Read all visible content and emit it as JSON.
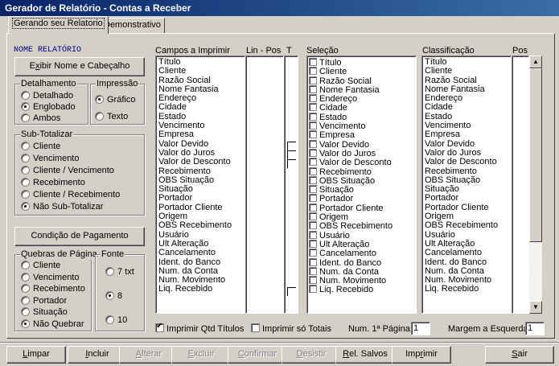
{
  "window": {
    "title": "Gerador de Relatório - Contas a Receber"
  },
  "tabs": [
    {
      "label": "Gerando seu Relatorio",
      "active": true
    },
    {
      "label": "Demonstrativo",
      "active": false
    }
  ],
  "left": {
    "section_title": "NOME RELATÓRIO",
    "exibir_button": {
      "pre": "E",
      "underline": "x",
      "post": "ibir Nome e Cabeçalho"
    },
    "detalhamento": {
      "label": "Detalhamento",
      "options": [
        {
          "label": "Detalhado",
          "selected": false
        },
        {
          "label": "Englobado",
          "selected": true
        },
        {
          "label": "Ambos",
          "selected": false
        }
      ]
    },
    "impressao": {
      "label": "Impressão",
      "options": [
        {
          "label": "Gráfico",
          "selected": true
        },
        {
          "label": "Texto",
          "selected": false
        }
      ]
    },
    "subtotalizar": {
      "label": "Sub-Totalizar",
      "options": [
        {
          "label": "Cliente",
          "selected": false
        },
        {
          "label": "Vencimento",
          "selected": false
        },
        {
          "label": "Cliente / Vencimento",
          "selected": false
        },
        {
          "label": "Recebimento",
          "selected": false
        },
        {
          "label": "Cliente / Recebimento",
          "selected": false
        },
        {
          "label": "Não Sub-Totalizar",
          "selected": true
        }
      ]
    },
    "condicao_button": "Condição de Pagamento",
    "quebras": {
      "label": "Quebras de Página",
      "options": [
        {
          "label": "Cliente",
          "selected": false
        },
        {
          "label": "Vencimento",
          "selected": false
        },
        {
          "label": "Recebimento",
          "selected": false
        },
        {
          "label": "Portador",
          "selected": false
        },
        {
          "label": "Situação",
          "selected": false
        },
        {
          "label": "Não Quebrar",
          "selected": true
        }
      ]
    },
    "fonte": {
      "label": "Fonte",
      "options": [
        {
          "label": "7 txt",
          "selected": false
        },
        {
          "label": "8",
          "selected": true
        },
        {
          "label": "10",
          "selected": false
        }
      ]
    }
  },
  "columns": {
    "campos": "Campos a Imprimir",
    "linpos": "Lin  -  Pos",
    "t": "T",
    "selecao": "Seleção",
    "classificacao": "Classificação",
    "pos": "Pos"
  },
  "campos": [
    "Título",
    "Cliente",
    "Razão Social",
    "Nome Fantasia",
    "Endereço",
    "Cidade",
    "Estado",
    "Vencimento",
    "Empresa",
    "Valor Devido",
    "Valor do Juros",
    "Valor de Desconto",
    "Recebimento",
    "OBS Situação",
    "Situação",
    "Portador",
    "Portador Cliente",
    "Origem",
    "OBS Recebimento",
    "Usuário",
    "Ult Alteração",
    "Cancelamento",
    "Ident. do Banco",
    "Num. da Conta",
    "Num. Movimento",
    "Liq. Recebido"
  ],
  "t_checked_rows": [
    9,
    10,
    11,
    25
  ],
  "bottom_options": {
    "qtd_titulos": {
      "label": "Imprimir Qtd Títulos",
      "checked": true
    },
    "so_totais": {
      "label": "Imprimir só Totais",
      "checked": false
    },
    "num_pagina_label": "Num. 1ª Página:",
    "num_pagina_value": "1",
    "margem_label": "Margem a Esquerda:",
    "margem_value": "1"
  },
  "toolbar": [
    {
      "pre": "",
      "u": "L",
      "post": "impar",
      "enabled": true
    },
    {
      "pre": "",
      "u": "I",
      "post": "ncluir",
      "enabled": true
    },
    {
      "pre": "",
      "u": "A",
      "post": "lterar",
      "enabled": false
    },
    {
      "pre": "",
      "u": "E",
      "post": "xcluir",
      "enabled": false
    },
    {
      "pre": "",
      "u": "C",
      "post": "onfirmar",
      "enabled": false
    },
    {
      "pre": "",
      "u": "D",
      "post": "esistir",
      "enabled": false
    },
    {
      "pre": "",
      "u": "R",
      "post": "el. Salvos",
      "enabled": true
    },
    {
      "pre": "Imp",
      "u": "r",
      "post": "imir",
      "enabled": true
    },
    {
      "pre": "",
      "u": "S",
      "post": "air",
      "enabled": true
    }
  ]
}
